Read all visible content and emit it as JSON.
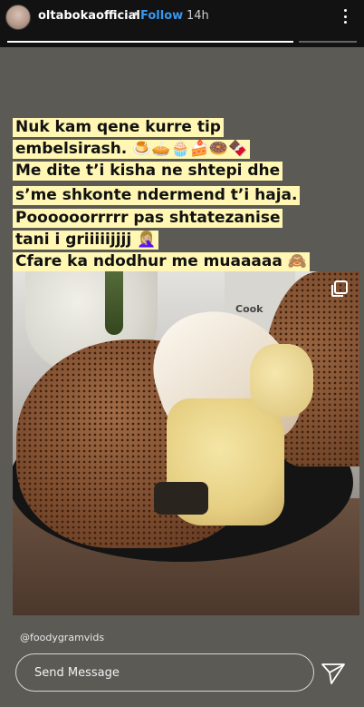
{
  "header": {
    "username": "oltabokaofficial",
    "separator": "•",
    "follow_label": "Follow",
    "time": "14h",
    "more_icon": "more-vertical-icon"
  },
  "progress": {
    "segments": [
      {
        "fill": 1.0
      },
      {
        "fill": 0.0
      }
    ]
  },
  "caption": {
    "lines": [
      "Nuk kam qene kurre tip",
      "embelsirash. 🍮🥧🧁🍰🍩🍫",
      "Me dite t’i kisha ne shtepi dhe",
      "s’me shkonte ndermend t’i haja.",
      "Poooooorrrrr pas shtatezanise",
      "tani i griiiiijjjj 🤦🏼‍♀️",
      "Cfare ka ndodhur me muaaaaa 🙈"
    ]
  },
  "media": {
    "canister_text": "Cook",
    "icon": "multiple-posts-icon"
  },
  "mention": "@foodygramvids",
  "reply": {
    "placeholder": "Send Message",
    "send_icon": "paper-plane-icon"
  },
  "colors": {
    "follow": "#3897f0",
    "caption_highlight": "#fff7b3",
    "header_bg": "#121212"
  }
}
